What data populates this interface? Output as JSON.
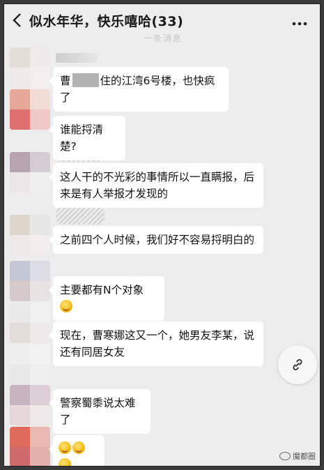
{
  "header": {
    "back_icon": "chevron-left-icon",
    "title": "似水年华，快乐嘻哈(33)",
    "more_icon": "more-dots-icon",
    "ghost_text": "一条消息"
  },
  "messages": [
    {
      "text_before": "曹",
      "text_after": "住的江湾6号楼，也快疯了",
      "redacted": true
    },
    {
      "text": "谁能捋清楚?"
    },
    {
      "line1": "这人干的不光彩的事情所以一直瞒报，后",
      "line2": "来是有人举报才发现的"
    },
    {
      "text": "之前四个人时候，我们好不容易捋明白的"
    },
    {
      "text": "主要都有N个对象"
    },
    {
      "line1": "现在，曹寒娜这又一个，她男友李某，说",
      "line2": "还有同居女友"
    },
    {
      "text": "警察蜀黍说太难了"
    },
    {
      "emojis": [
        "grin-emoji",
        "grin-emoji",
        "grin-emoji"
      ]
    }
  ],
  "link_button_icon": "link-icon",
  "watermark": {
    "text": "魔都圈",
    "icon": "wechat-icon"
  }
}
